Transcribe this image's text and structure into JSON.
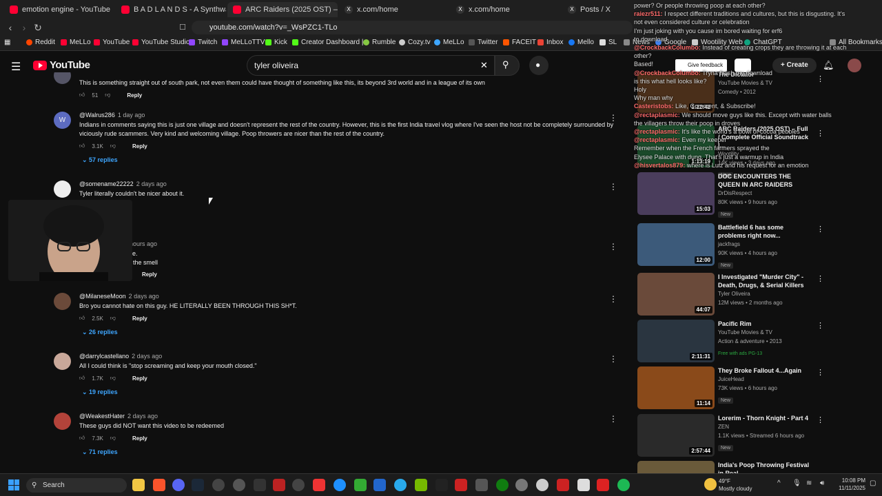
{
  "tabs": [
    {
      "label": "emotion engine - YouTube",
      "icon": "youtube-icon"
    },
    {
      "label": "B A D L A N D S - A Synthwave Mix f",
      "icon": "youtube-icon"
    },
    {
      "label": "ARC Raiders (2025 OST) – Full / C",
      "icon": "youtube-icon"
    },
    {
      "label": "x.com/home",
      "icon": "x-icon"
    },
    {
      "label": "x.com/home",
      "icon": "x-icon"
    },
    {
      "label": "Posts / X",
      "icon": "x-icon"
    }
  ],
  "address": {
    "url": "youtube.com/watch?v=_WsPZC1-TLo"
  },
  "bookmarks": [
    "Reddit",
    "MeLLo",
    "YouTube",
    "YouTube Studio",
    "Twitch",
    "MeLLoTTV",
    "Kick",
    "Creator Dashboard |...",
    "Rumble",
    "Cozy.tv",
    "MeLLo",
    "Twitter",
    "FACEIT",
    "Inbox",
    "Mello",
    "SL",
    "News",
    "Google",
    "Wootility Web",
    "ChatGPT",
    "All Bookmarks"
  ],
  "youtube": {
    "logo": "YouTube",
    "search_value": "tyler oliveira",
    "create_label": "Create",
    "feedback_label": "Give feedback"
  },
  "comments": [
    {
      "author": "",
      "time": "",
      "text": "This is something straight out of south park, not even them could have thought of something like this, its beyond 3rd world and in a league of its own",
      "likes": "51",
      "replies": ""
    },
    {
      "author": "@Walrus286",
      "time": "1 day ago",
      "text": "Indians in comments saying this is just one village and doesn't represent the rest of the country. However, this is the first India travel vlog where I've seen the host not be completely surrounded by viciously rude scammers. Very kind and welcoming village. Poop throwers are nicer than the rest of the country.",
      "likes": "3.1K",
      "replies": "57 replies"
    },
    {
      "author": "@somename22222",
      "time": "2 days ago",
      "text": "Tyler literally couldn't be nicer about it.",
      "likes": "",
      "replies": "lies"
    },
    {
      "author": "s24",
      "time": "5 hours ago",
      "text": "on dome.\nlome is the smell",
      "likes": "",
      "replies": ""
    },
    {
      "author": "@MilaneseMoon",
      "time": "2 days ago",
      "text": "Bro you cannot hate on this guy. HE LITERALLY BEEN THROUGH THIS SH*T.",
      "likes": "2.5K",
      "replies": "26 replies"
    },
    {
      "author": "@darrylcastellano",
      "time": "2 days ago",
      "text": "All I could think is \"stop screaming and keep your mouth closed.\"",
      "likes": "1.7K",
      "replies": "19 replies"
    },
    {
      "author": "@WeakestHater",
      "time": "2 days ago",
      "text": "These guys did NOT want this video to be redeemed",
      "likes": "7.3K",
      "replies": "71 replies"
    }
  ],
  "reply_label": "Reply",
  "sidebar": [
    {
      "title": "The Dictator",
      "channel": "YouTube Movies & TV",
      "meta": "Comedy • 2012",
      "badge": "",
      "duration": "1:22:42"
    },
    {
      "title": "ARC Raiders (2025 OST) – Full / Complete Official Soundtrack |...",
      "channel": "Wootility",
      "meta": "14K views • 3 days ago",
      "badge": "New",
      "duration": "1:13:19"
    },
    {
      "title": "DOC ENCOUNTERS THE QUEEN IN ARC RAIDERS",
      "channel": "DrDisRespect",
      "meta": "80K views • 9 hours ago",
      "badge": "New",
      "duration": "15:03"
    },
    {
      "title": "Battlefield 6 has some problems right now...",
      "channel": "jackfrags",
      "meta": "90K views • 4 hours ago",
      "badge": "New",
      "duration": "12:00"
    },
    {
      "title": "I Investigated \"Murder City\" - Death, Drugs, & Serial Killers",
      "channel": "Tyler Oliveira",
      "meta": "12M views • 2 months ago",
      "badge": "",
      "duration": "44:07"
    },
    {
      "title": "Pacific Rim",
      "channel": "YouTube Movies & TV",
      "meta": "Action & adventure • 2013",
      "badge": "Free with ads  PG-13",
      "duration": "2:11:31"
    },
    {
      "title": "They Broke Fallout 4...Again",
      "channel": "JuiceHead",
      "meta": "73K views • 6 hours ago",
      "badge": "New",
      "duration": "11:14"
    },
    {
      "title": "Lorerim - Thorn Knight - Part 4",
      "channel": "ZEN",
      "meta": "1.1K views • Streamed 6 hours ago",
      "badge": "New",
      "duration": "2:57:44"
    },
    {
      "title": "India's Poop Throwing Festival in Real",
      "channel": "",
      "meta": "",
      "badge": "",
      "duration": ""
    }
  ],
  "chat": [
    {
      "user": "",
      "text": "power? Or people throwing poop at each other?"
    },
    {
      "user": "raiezr511:",
      "text": "I respect different traditions and cultures, but this is disgusting. It's"
    },
    {
      "user": "",
      "text": "not even considered culture or celebration"
    },
    {
      "user": "",
      "text": "I'm just joking with you cause im bored waiting for erf6"
    },
    {
      "user": "",
      "text": "to download"
    },
    {
      "user": "@CrockbackColumbo:",
      "text": "Instead of creating crops they are throwing it at each"
    },
    {
      "user": "",
      "text": "other?"
    },
    {
      "user": "",
      "text": "Based!"
    },
    {
      "user": "@CrockbackColumbo:",
      "text": "Tryna finish my download"
    },
    {
      "user": "",
      "text": "is this what hell looks like?"
    },
    {
      "user": "",
      "text": "Holy"
    },
    {
      "user": "",
      "text": "Why man why"
    },
    {
      "user": "Casteristobs:",
      "text": "Like, Comment, & Subscribe!"
    },
    {
      "user": "@rectaplasmic:",
      "text": "We should move guys like this. Except with water balls"
    },
    {
      "user": "",
      "text": "the villagers throw their poop in droves"
    },
    {
      "user": "@rectaplasmic:",
      "text": "It's like the world's a bowl of cocoa pebbles"
    },
    {
      "user": "@rectaplasmic:",
      "text": "Even my keeper"
    },
    {
      "user": "",
      "text": "Remember when the French farmers sprayed the"
    },
    {
      "user": "",
      "text": "Elysee Palace with dung. That's just a warmup in India"
    },
    {
      "user": "@hisvertalos879:",
      "text": "where is Luiz and his request for an emotion"
    }
  ],
  "taskbar": {
    "search_label": "Search",
    "weather_temp": "49°F",
    "weather_desc": "Mostly cloudy",
    "time": "10:08 PM",
    "date": "11/11/2025"
  },
  "colors": {
    "accent": "#3ea6ff",
    "brand": "#ff0033",
    "chat_name": "#ff6b6b"
  }
}
